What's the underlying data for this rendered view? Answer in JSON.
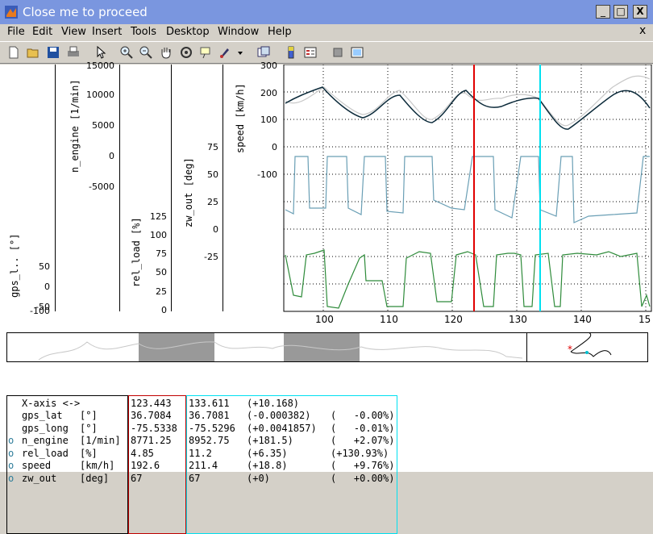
{
  "window": {
    "title": "Close me to proceed",
    "minimize": "_",
    "maximize": "□",
    "close": "X"
  },
  "menu": [
    "File",
    "Edit",
    "View",
    "Insert",
    "Tools",
    "Desktop",
    "Window",
    "Help"
  ],
  "menu_close": "x",
  "toolbar_icons": [
    "new-file-icon",
    "open-folder-icon",
    "save-icon",
    "print-icon",
    "pointer-icon",
    "zoom-in-icon",
    "zoom-out-icon",
    "pan-hand-icon",
    "rotate-3d-icon",
    "data-cursor-icon",
    "brush-icon",
    "dropdown-arrow-icon",
    "link-plot-icon",
    "colorbar-icon",
    "legend-icon",
    "hide-plot-tools-icon",
    "show-plot-tools-icon"
  ],
  "axes": {
    "gps": {
      "label": "gps_l.. [°]",
      "ticks": [
        "50",
        "0",
        "-50",
        "-100"
      ]
    },
    "n_engine": {
      "label": "n_engine [1/min]",
      "ticks": [
        "15000",
        "10000",
        "5000",
        "0",
        "-5000"
      ]
    },
    "rel_load": {
      "label": "rel_load [%]",
      "ticks": [
        "125",
        "100",
        "75",
        "50",
        "25",
        "0"
      ]
    },
    "zw_out": {
      "label": "zw_out [deg]",
      "ticks": [
        "75",
        "50",
        "25",
        "0",
        "-25"
      ]
    },
    "speed": {
      "label": "speed [km/h]",
      "ticks": [
        "300",
        "200",
        "100",
        "0",
        "-100"
      ]
    }
  },
  "chart_data": {
    "type": "line",
    "xlim": [
      93,
      150
    ],
    "x_ticks": [
      "100",
      "110",
      "120",
      "130",
      "140",
      "15"
    ],
    "cursor_red_x": 123.443,
    "cursor_cyan_x": 133.611,
    "grid": true,
    "colors": {
      "speed": "#0b2a3a",
      "speed_ref": "#c8c8c8",
      "rel_load": "#6a9fb5",
      "zw_out": "#2e8b3a",
      "cursor_red": "#e00000",
      "cursor_cyan": "#00e0f0"
    }
  },
  "info": {
    "header": [
      "X-axis <->",
      "123.443",
      "133.611",
      "(+10.168)"
    ],
    "rows": [
      {
        "marker": "",
        "name": "gps_lat",
        "unit": "[°]",
        "v1": "36.7084",
        "v2": "36.7081",
        "diff": "(-0.000382)",
        "pct": "(   -0.00%)"
      },
      {
        "marker": "",
        "name": "gps_long",
        "unit": "[°]",
        "v1": "-75.5338",
        "v2": "-75.5296",
        "diff": "(+0.0041857)",
        "pct": "(   -0.01%)"
      },
      {
        "marker": "o",
        "name": "n_engine",
        "unit": "[1/min]",
        "v1": "8771.25",
        "v2": "8952.75",
        "diff": "(+181.5)",
        "pct": "(   +2.07%)"
      },
      {
        "marker": "o",
        "name": "rel_load",
        "unit": "[%]",
        "v1": "4.85",
        "v2": "11.2",
        "diff": "(+6.35)",
        "pct": "(+130.93%)"
      },
      {
        "marker": "o",
        "name": "speed",
        "unit": "[km/h]",
        "v1": "192.6",
        "v2": "211.4",
        "diff": "(+18.8)",
        "pct": "(   +9.76%)"
      },
      {
        "marker": "o",
        "name": "zw_out",
        "unit": "[deg]",
        "v1": "67",
        "v2": "67",
        "diff": "(+0)",
        "pct": "(   +0.00%)"
      }
    ]
  }
}
